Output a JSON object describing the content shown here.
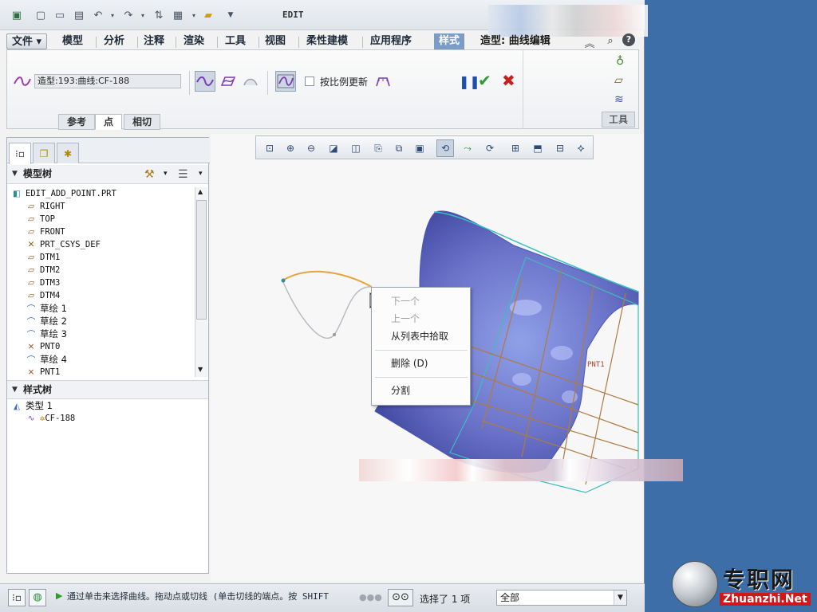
{
  "window": {
    "title": "EDIT"
  },
  "ribbon_tabs": [
    {
      "label": "文件 ▾"
    },
    {
      "label": "模型"
    },
    {
      "label": "分析"
    },
    {
      "label": "注释"
    },
    {
      "label": "渲染"
    },
    {
      "label": "工具"
    },
    {
      "label": "视图"
    },
    {
      "label": "柔性建模"
    },
    {
      "label": "应用程序"
    },
    {
      "label": "样式"
    },
    {
      "label": "造型: 曲线编辑"
    }
  ],
  "ribbon": {
    "curve_name": "造型:193:曲线:CF-188",
    "scale_update_label": "按比例更新",
    "subtabs": [
      "参考",
      "点",
      "相切"
    ],
    "tools_label": "工具"
  },
  "model_tree": {
    "header": "模型树",
    "root": "EDIT_ADD_POINT.PRT",
    "items": [
      {
        "label": "RIGHT",
        "icon": "datum-plane-icon"
      },
      {
        "label": "TOP",
        "icon": "datum-plane-icon"
      },
      {
        "label": "FRONT",
        "icon": "datum-plane-icon"
      },
      {
        "label": "PRT_CSYS_DEF",
        "icon": "csys-icon"
      },
      {
        "label": "DTM1",
        "icon": "datum-plane-icon"
      },
      {
        "label": "DTM2",
        "icon": "datum-plane-icon"
      },
      {
        "label": "DTM3",
        "icon": "datum-plane-icon"
      },
      {
        "label": "DTM4",
        "icon": "datum-plane-icon"
      },
      {
        "label": "草绘 1",
        "icon": "sketch-icon"
      },
      {
        "label": "草绘 2",
        "icon": "sketch-icon"
      },
      {
        "label": "草绘 3",
        "icon": "sketch-icon"
      },
      {
        "label": "PNT0",
        "icon": "datum-point-icon"
      },
      {
        "label": "草绘 4",
        "icon": "sketch-icon"
      },
      {
        "label": "PNT1",
        "icon": "datum-point-icon"
      }
    ]
  },
  "style_tree": {
    "header": "样式树",
    "type_item": "类型 1",
    "curve_item": "CF-188"
  },
  "context_menu": {
    "items": [
      {
        "label": "下一个",
        "disabled": true
      },
      {
        "label": "上一个",
        "disabled": true
      },
      {
        "label": "从列表中拾取",
        "disabled": false
      },
      {
        "label": "删除 (D)",
        "disabled": false
      },
      {
        "label": "分割",
        "disabled": false
      }
    ]
  },
  "viewport": {
    "point_label": "PNT1"
  },
  "status_bar": {
    "message": "通过单击来选择曲线。拖动点或切线 (单击切线的端点。按 SHIFT",
    "selection": "选择了 1 项",
    "filter_value": "全部"
  },
  "watermark": {
    "cn": "专职网",
    "en": "Zhuanzhi.Net"
  },
  "colors": {
    "desktop": "#3d6ea8",
    "surface": "#6a72c8",
    "curve_orange": "#e8a43a",
    "active_tab": "#7a9cc6"
  }
}
